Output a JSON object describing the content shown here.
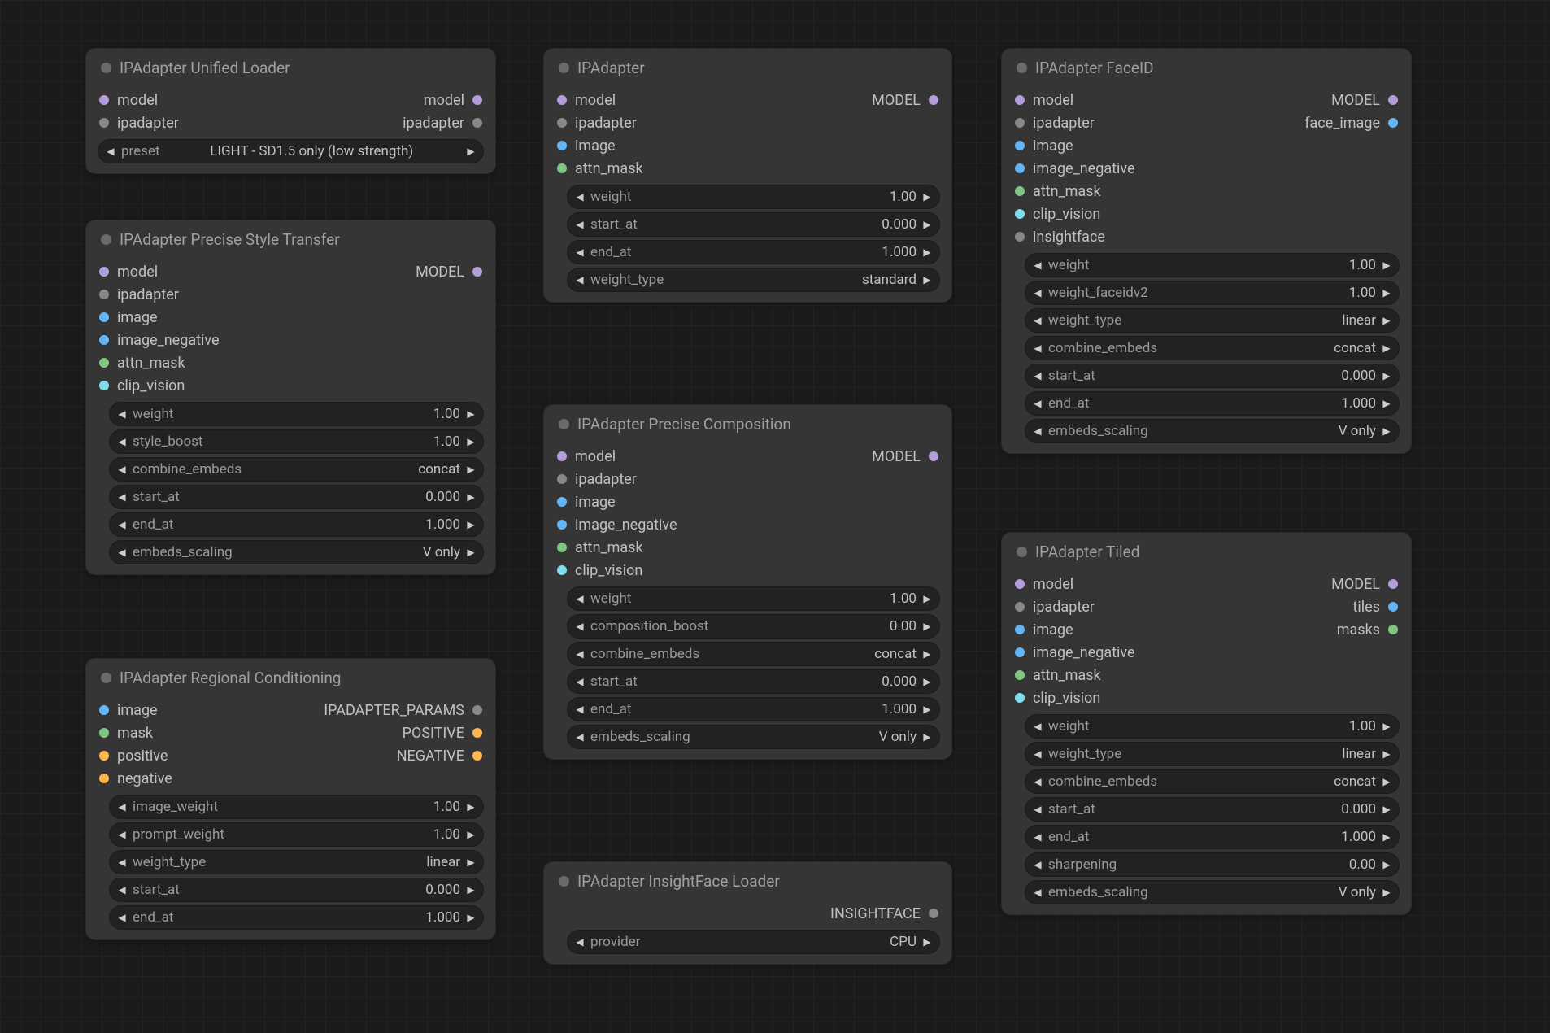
{
  "nodes": {
    "unified_loader": {
      "title": "IPAdapter Unified Loader",
      "inputs": {
        "model": "model",
        "ipadapter": "ipadapter"
      },
      "outputs": {
        "model": "model",
        "ipadapter": "ipadapter"
      },
      "preset_label": "preset",
      "preset_value": "LIGHT - SD1.5 only (low strength)"
    },
    "ipadapter": {
      "title": "IPAdapter",
      "inputs": {
        "model": "model",
        "ipadapter": "ipadapter",
        "image": "image",
        "attn_mask": "attn_mask"
      },
      "outputs": {
        "model": "MODEL"
      },
      "widgets": [
        {
          "name": "weight",
          "value": "1.00"
        },
        {
          "name": "start_at",
          "value": "0.000"
        },
        {
          "name": "end_at",
          "value": "1.000"
        },
        {
          "name": "weight_type",
          "value": "standard"
        }
      ]
    },
    "faceid": {
      "title": "IPAdapter FaceID",
      "inputs": {
        "model": "model",
        "ipadapter": "ipadapter",
        "image": "image",
        "image_negative": "image_negative",
        "attn_mask": "attn_mask",
        "clip_vision": "clip_vision",
        "insightface": "insightface"
      },
      "outputs": {
        "model": "MODEL",
        "face_image": "face_image"
      },
      "widgets": [
        {
          "name": "weight",
          "value": "1.00"
        },
        {
          "name": "weight_faceidv2",
          "value": "1.00"
        },
        {
          "name": "weight_type",
          "value": "linear"
        },
        {
          "name": "combine_embeds",
          "value": "concat"
        },
        {
          "name": "start_at",
          "value": "0.000"
        },
        {
          "name": "end_at",
          "value": "1.000"
        },
        {
          "name": "embeds_scaling",
          "value": "V only"
        }
      ]
    },
    "precise_style": {
      "title": "IPAdapter Precise Style Transfer",
      "inputs": {
        "model": "model",
        "ipadapter": "ipadapter",
        "image": "image",
        "image_negative": "image_negative",
        "attn_mask": "attn_mask",
        "clip_vision": "clip_vision"
      },
      "outputs": {
        "model": "MODEL"
      },
      "widgets": [
        {
          "name": "weight",
          "value": "1.00"
        },
        {
          "name": "style_boost",
          "value": "1.00"
        },
        {
          "name": "combine_embeds",
          "value": "concat"
        },
        {
          "name": "start_at",
          "value": "0.000"
        },
        {
          "name": "end_at",
          "value": "1.000"
        },
        {
          "name": "embeds_scaling",
          "value": "V only"
        }
      ]
    },
    "precise_comp": {
      "title": "IPAdapter Precise Composition",
      "inputs": {
        "model": "model",
        "ipadapter": "ipadapter",
        "image": "image",
        "image_negative": "image_negative",
        "attn_mask": "attn_mask",
        "clip_vision": "clip_vision"
      },
      "outputs": {
        "model": "MODEL"
      },
      "widgets": [
        {
          "name": "weight",
          "value": "1.00"
        },
        {
          "name": "composition_boost",
          "value": "0.00"
        },
        {
          "name": "combine_embeds",
          "value": "concat"
        },
        {
          "name": "start_at",
          "value": "0.000"
        },
        {
          "name": "end_at",
          "value": "1.000"
        },
        {
          "name": "embeds_scaling",
          "value": "V only"
        }
      ]
    },
    "tiled": {
      "title": "IPAdapter Tiled",
      "inputs": {
        "model": "model",
        "ipadapter": "ipadapter",
        "image": "image",
        "image_negative": "image_negative",
        "attn_mask": "attn_mask",
        "clip_vision": "clip_vision"
      },
      "outputs": {
        "model": "MODEL",
        "tiles": "tiles",
        "masks": "masks"
      },
      "widgets": [
        {
          "name": "weight",
          "value": "1.00"
        },
        {
          "name": "weight_type",
          "value": "linear"
        },
        {
          "name": "combine_embeds",
          "value": "concat"
        },
        {
          "name": "start_at",
          "value": "0.000"
        },
        {
          "name": "end_at",
          "value": "1.000"
        },
        {
          "name": "sharpening",
          "value": "0.00"
        },
        {
          "name": "embeds_scaling",
          "value": "V only"
        }
      ]
    },
    "regional": {
      "title": "IPAdapter Regional Conditioning",
      "inputs": {
        "image": "image",
        "mask": "mask",
        "positive": "positive",
        "negative": "negative"
      },
      "outputs": {
        "params": "IPADAPTER_PARAMS",
        "positive": "POSITIVE",
        "negative": "NEGATIVE"
      },
      "widgets": [
        {
          "name": "image_weight",
          "value": "1.00"
        },
        {
          "name": "prompt_weight",
          "value": "1.00"
        },
        {
          "name": "weight_type",
          "value": "linear"
        },
        {
          "name": "start_at",
          "value": "0.000"
        },
        {
          "name": "end_at",
          "value": "1.000"
        }
      ]
    },
    "insightface": {
      "title": "IPAdapter InsightFace Loader",
      "outputs": {
        "insightface": "INSIGHTFACE"
      },
      "widgets": [
        {
          "name": "provider",
          "value": "CPU"
        }
      ]
    }
  }
}
